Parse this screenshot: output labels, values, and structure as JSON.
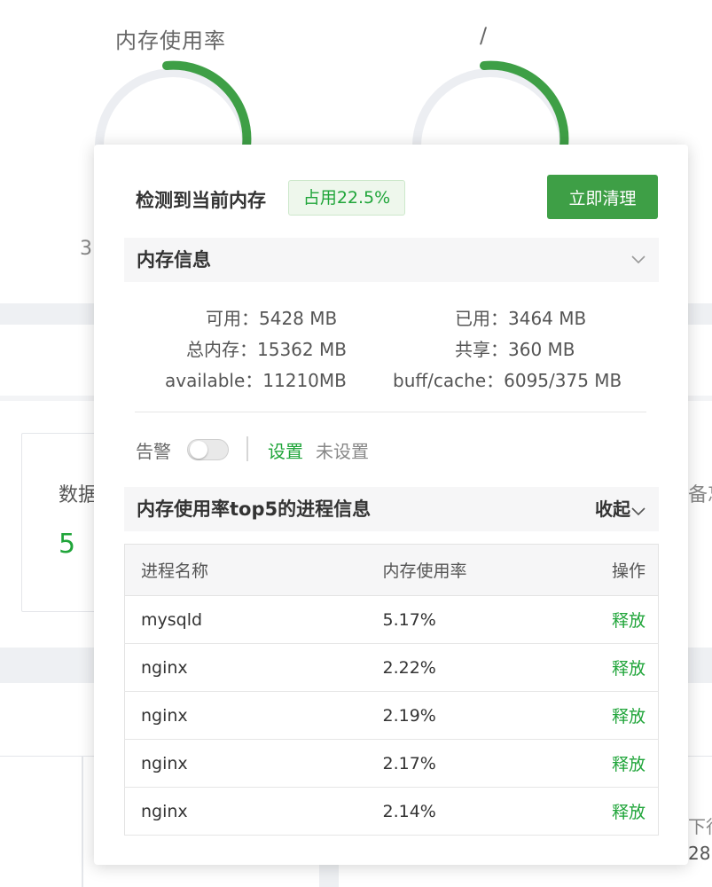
{
  "background": {
    "gauge1_title": "内存使用率",
    "gauge2_title": "/",
    "stat_label": "数据",
    "stat_value": "5",
    "left_partial": "3",
    "right_partial_1": "备忘",
    "right_partial_2": "下行",
    "right_partial_3": "28",
    "accent": "#20a53a"
  },
  "popup": {
    "title": "检测到当前内存",
    "usage_badge": "占用22.5%",
    "clean_button": "立即清理",
    "memory_section": {
      "title": "内存信息",
      "rows": [
        {
          "l1": "可用：",
          "v1": "5428 MB",
          "l2": "已用：",
          "v2": "3464 MB"
        },
        {
          "l1": "总内存：",
          "v1": "15362 MB",
          "l2": "共享：",
          "v2": "360 MB"
        },
        {
          "l1": "available：",
          "v1": "11210MB",
          "l2": "buff/cache：",
          "v2": "6095/375 MB"
        }
      ]
    },
    "alarm": {
      "label": "告警",
      "toggle_on": false,
      "settings_link": "设置",
      "status": "未设置"
    },
    "process_section": {
      "title": "内存使用率top5的进程信息",
      "collapse": "收起",
      "columns": [
        "进程名称",
        "内存使用率",
        "操作"
      ],
      "rows": [
        {
          "name": "mysqld",
          "usage": "5.17%",
          "action": "释放"
        },
        {
          "name": "nginx",
          "usage": "2.22%",
          "action": "释放"
        },
        {
          "name": "nginx",
          "usage": "2.19%",
          "action": "释放"
        },
        {
          "name": "nginx",
          "usage": "2.17%",
          "action": "释放"
        },
        {
          "name": "nginx",
          "usage": "2.14%",
          "action": "释放"
        }
      ]
    }
  }
}
